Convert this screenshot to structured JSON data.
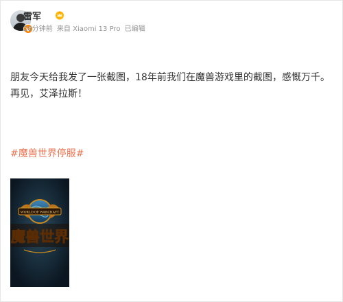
{
  "post": {
    "username": "雷军",
    "time": "28分钟前",
    "source": "来自 Xiaomi 13 Pro",
    "edited": "已编辑",
    "text": "朋友今天给我发了一张截图，18年前我们在魔兽游戏里的截图，感慨万千。再见，艾泽拉斯！",
    "hashtag": "#魔兽世界停服#"
  },
  "image": {
    "logo_small": "WORLD OF WARCRAFT",
    "logo_title": "魔兽世界"
  },
  "icons": {
    "verified": "vip-badge-icon",
    "member": "crown-icon"
  },
  "colors": {
    "link": "#eb7350",
    "meta": "#939393",
    "badge": "#ff8200"
  }
}
